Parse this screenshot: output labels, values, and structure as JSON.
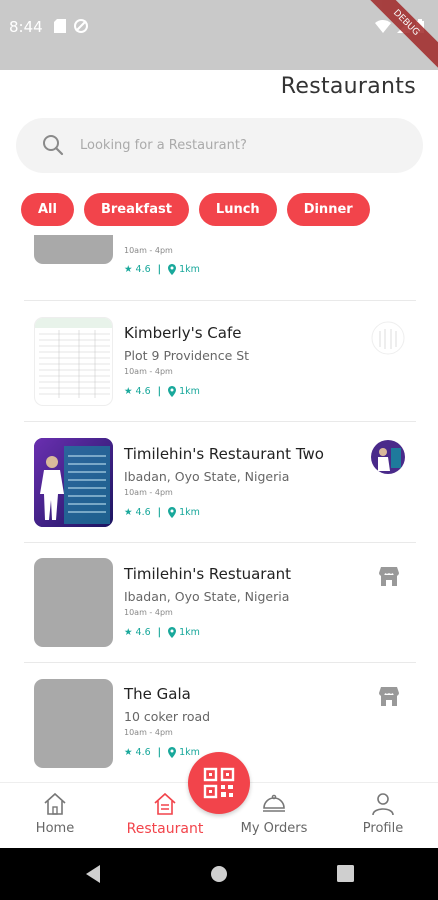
{
  "status": {
    "time": "8:44",
    "debug_label": "DEBUG"
  },
  "page_title": "Restaurants",
  "search": {
    "placeholder": "Looking for a Restaurant?"
  },
  "filters": [
    "All",
    "Breakfast",
    "Lunch",
    "Dinner"
  ],
  "restaurants": [
    {
      "name": "",
      "address": "",
      "hours": "10am - 4pm",
      "rating": "4.6",
      "distance": "1km"
    },
    {
      "name": "Kimberly's Cafe",
      "address": "Plot 9 Providence St",
      "hours": "10am - 4pm",
      "rating": "4.6",
      "distance": "1km"
    },
    {
      "name": "Timilehin's Restaurant Two",
      "address": "Ibadan, Oyo State, Nigeria",
      "hours": "10am - 4pm",
      "rating": "4.6",
      "distance": "1km"
    },
    {
      "name": "Timilehin's Restuarant",
      "address": "Ibadan, Oyo State, Nigeria",
      "hours": "10am - 4pm",
      "rating": "4.6",
      "distance": "1km"
    },
    {
      "name": "The Gala",
      "address": "10 coker road",
      "hours": "10am - 4pm",
      "rating": "4.6",
      "distance": "1km"
    }
  ],
  "nav": {
    "home": "Home",
    "restaurant": "Restaurant",
    "orders": "My Orders",
    "profile": "Profile"
  },
  "colors": {
    "accent": "#f2444b",
    "teal": "#19a89b",
    "placeholder_thumb": "#a9a9a9"
  }
}
